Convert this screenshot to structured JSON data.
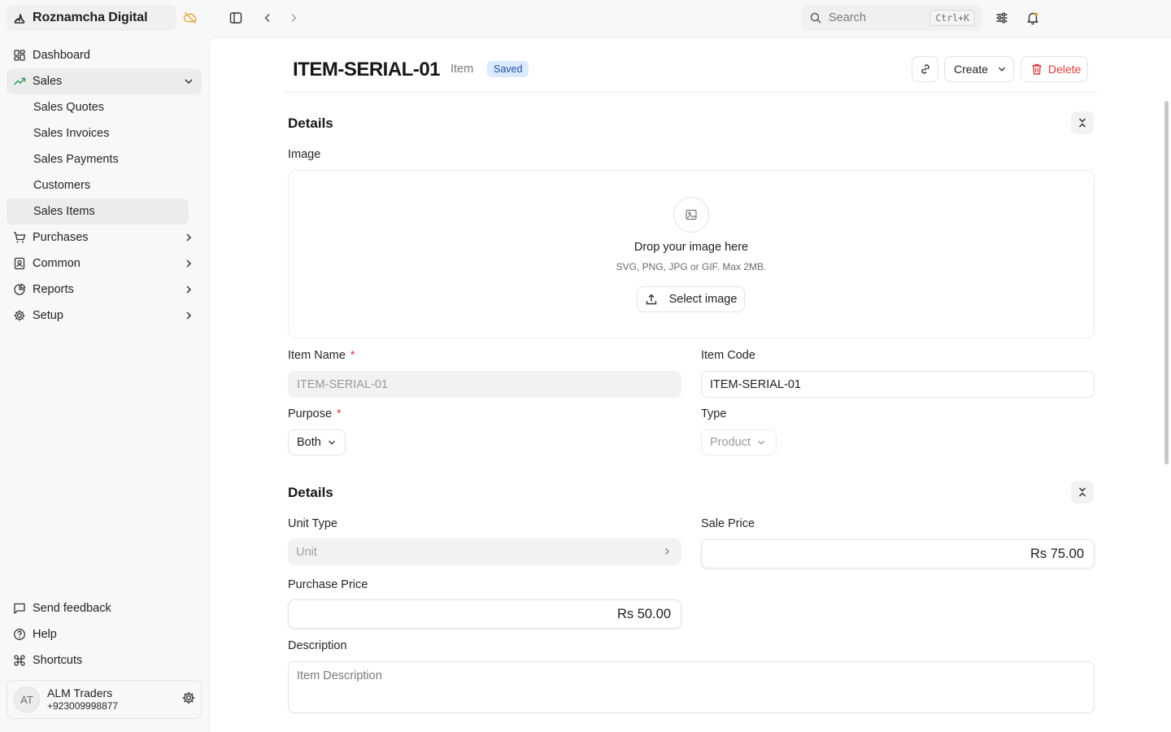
{
  "app": {
    "name": "Roznamcha Digital"
  },
  "sidebar": {
    "items": [
      {
        "label": "Dashboard"
      },
      {
        "label": "Sales"
      },
      {
        "label": "Purchases"
      },
      {
        "label": "Common"
      },
      {
        "label": "Reports"
      },
      {
        "label": "Setup"
      }
    ],
    "sales_sub": [
      {
        "label": "Sales Quotes"
      },
      {
        "label": "Sales Invoices"
      },
      {
        "label": "Sales Payments"
      },
      {
        "label": "Customers"
      },
      {
        "label": "Sales Items"
      }
    ],
    "footer": [
      {
        "label": "Send feedback"
      },
      {
        "label": "Help"
      },
      {
        "label": "Shortcuts"
      }
    ],
    "account": {
      "initials": "AT",
      "name": "ALM Traders",
      "phone": "+923009998877"
    }
  },
  "search": {
    "placeholder": "Search",
    "shortcut": "Ctrl+K"
  },
  "doc": {
    "title": "ITEM-SERIAL-01",
    "doctype": "Item",
    "status": "Saved",
    "create_label": "Create",
    "delete_label": "Delete"
  },
  "section1": {
    "title": "Details",
    "image_label": "Image",
    "drop_title": "Drop your image here",
    "drop_sub": "SVG, PNG, JPG or GIF. Max 2MB.",
    "select_image_label": "Select image",
    "item_name_label": "Item Name",
    "item_name_value": "ITEM-SERIAL-01",
    "item_code_label": "Item Code",
    "item_code_value": "ITEM-SERIAL-01",
    "purpose_label": "Purpose",
    "purpose_value": "Both",
    "type_label": "Type",
    "type_value": "Product",
    "required_mark": "*"
  },
  "section2": {
    "title": "Details",
    "unit_type_label": "Unit Type",
    "unit_type_placeholder": "Unit",
    "sale_price_label": "Sale Price",
    "sale_price_value": "Rs 75.00",
    "purchase_price_label": "Purchase Price",
    "purchase_price_value": "Rs 50.00",
    "description_label": "Description",
    "description_placeholder": "Item Description"
  },
  "colors": {
    "danger": "#e03b3b",
    "saved_badge_bg": "#dbeafe",
    "saved_badge_text": "#1e4fa8",
    "offline_icon": "#e8a33b"
  }
}
